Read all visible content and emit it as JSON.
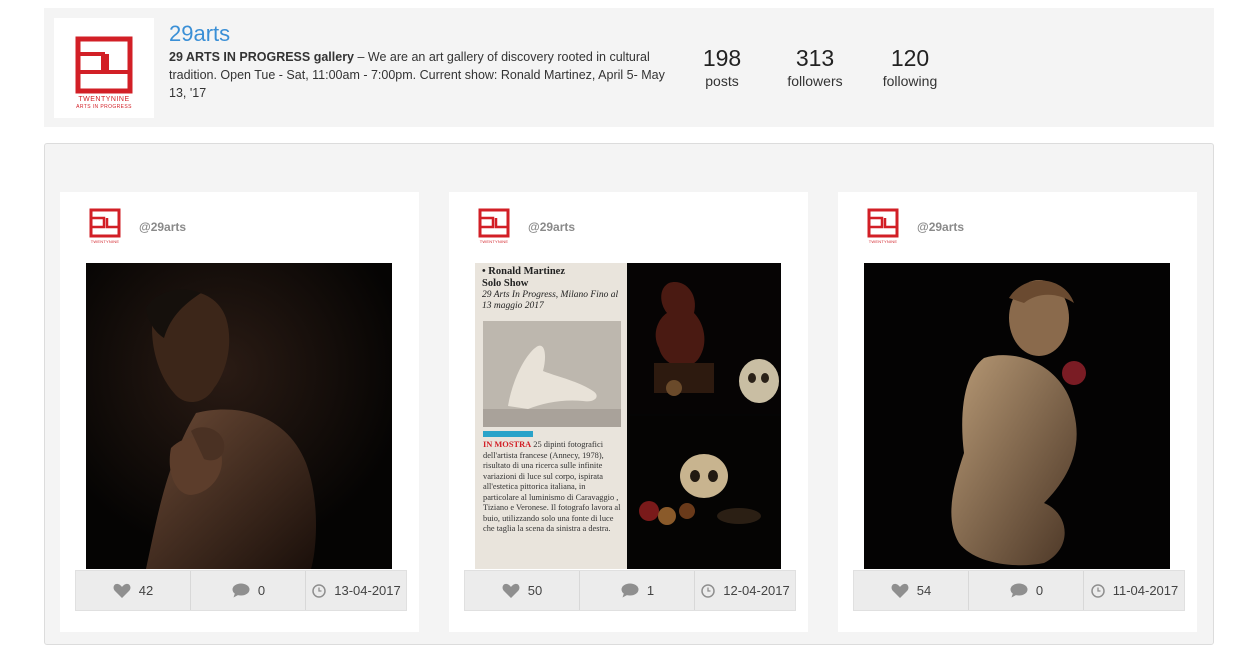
{
  "profile": {
    "handle": "29arts",
    "logo_caption_top": "TWENTYNINE",
    "logo_caption_bottom": "ARTS IN PROGRESS",
    "bio_name": "29 ARTS IN PROGRESS gallery",
    "bio_text": " – We are an art gallery of discovery rooted in cultural tradition. Open Tue - Sat, 11:00am - 7:00pm. Current show: Ronald Martinez, April 5- May 13, '17",
    "stats": [
      {
        "value": "198",
        "label": "posts"
      },
      {
        "value": "313",
        "label": "followers"
      },
      {
        "value": "120",
        "label": "following"
      }
    ]
  },
  "posts": [
    {
      "username": "@29arts",
      "likes": "42",
      "comments": "0",
      "date": "13-04-2017"
    },
    {
      "username": "@29arts",
      "likes": "50",
      "comments": "1",
      "date": "12-04-2017"
    },
    {
      "username": "@29arts",
      "likes": "54",
      "comments": "0",
      "date": "11-04-2017"
    }
  ],
  "clipping": {
    "title_line1": "• Ronald Martinez",
    "title_line2": "Solo Show",
    "subtitle": "29 Arts In Progress, Milano Fino al 13 maggio 2017",
    "label": "IN MOSTRA",
    "body": " 25 dipinti fotografici dell'artista francese (Annecy, 1978), risultato di una ricerca sulle infinite variazioni di luce sul corpo, ispirata all'estetica pittorica italiana, in particolare al luminismo di Caravaggio , Tiziano e Veronese. Il fotografo lavora al buio, utilizzando solo una fonte di luce che taglia la scena da sinistra a destra."
  },
  "colors": {
    "brand_red": "#d21f26",
    "link_blue": "#3a8fd6"
  },
  "icons": {
    "like": "heart-icon",
    "comment": "speech-bubble-icon",
    "date": "clock-icon"
  }
}
